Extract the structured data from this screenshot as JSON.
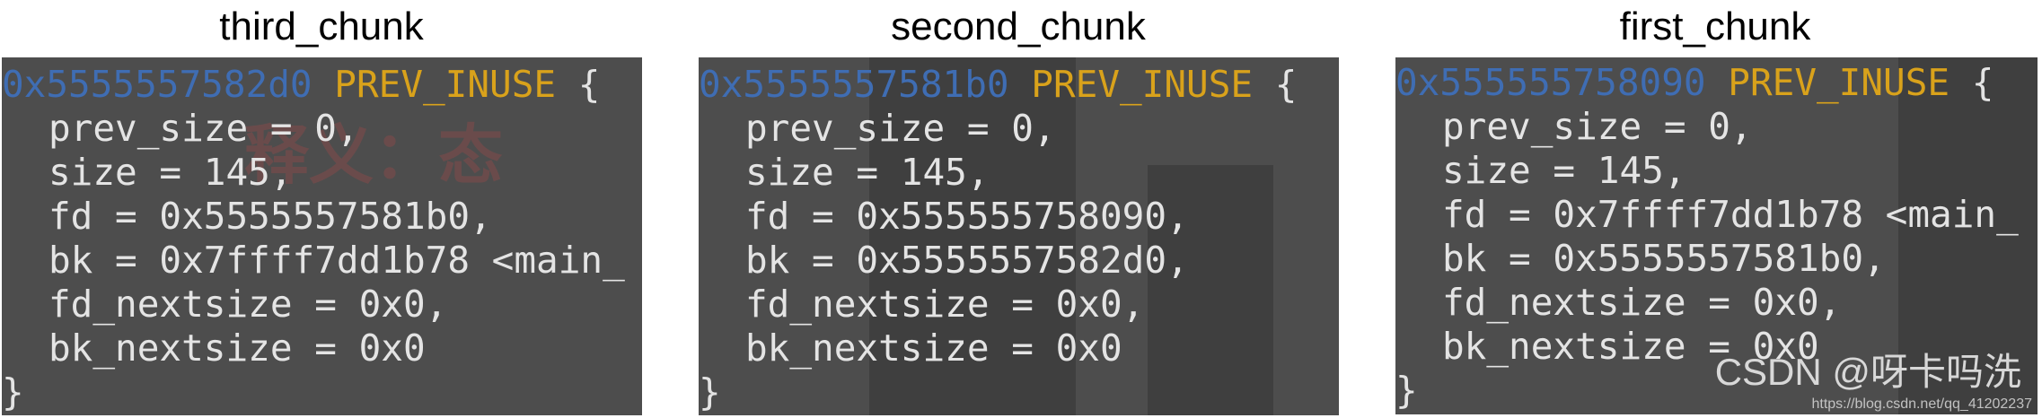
{
  "panels": [
    {
      "title": "third_chunk",
      "header_addr": "0x5555557582d0",
      "header_flag": "PREV_INUSE",
      "header_brace": "{",
      "lines": [
        "prev_size = 0,",
        "size = 145,",
        "fd = 0x5555557581b0,",
        "bk = 0x7ffff7dd1b78 <main_",
        "fd_nextsize = 0x0,",
        "bk_nextsize = 0x0"
      ],
      "closing": "}",
      "watermark": "释义：态"
    },
    {
      "title": "second_chunk",
      "header_addr": "0x5555557581b0",
      "header_flag": "PREV_INUSE",
      "header_brace": "{",
      "lines": [
        "prev_size = 0,",
        "size = 145,",
        "fd = 0x555555758090,",
        "bk = 0x5555557582d0,",
        "fd_nextsize = 0x0,",
        "bk_nextsize = 0x0"
      ],
      "closing": "}"
    },
    {
      "title": "first_chunk",
      "header_addr": "0x555555758090",
      "header_flag": "PREV_INUSE",
      "header_brace": "{",
      "lines": [
        "prev_size = 0,",
        "size = 145,",
        "fd = 0x7ffff7dd1b78 <main_",
        "bk = 0x5555557581b0,",
        "fd_nextsize = 0x0,",
        "bk_nextsize = 0x0"
      ],
      "closing": "}",
      "csdn_mark": "CSDN @呀卡吗洗",
      "csdn_url": "https://blog.csdn.net/qq_41202237"
    }
  ],
  "colors": {
    "terminal_bg": "#4d4d4d",
    "address": "#3f6db3",
    "flag": "#d9a21b",
    "text": "#e4e4e4"
  }
}
